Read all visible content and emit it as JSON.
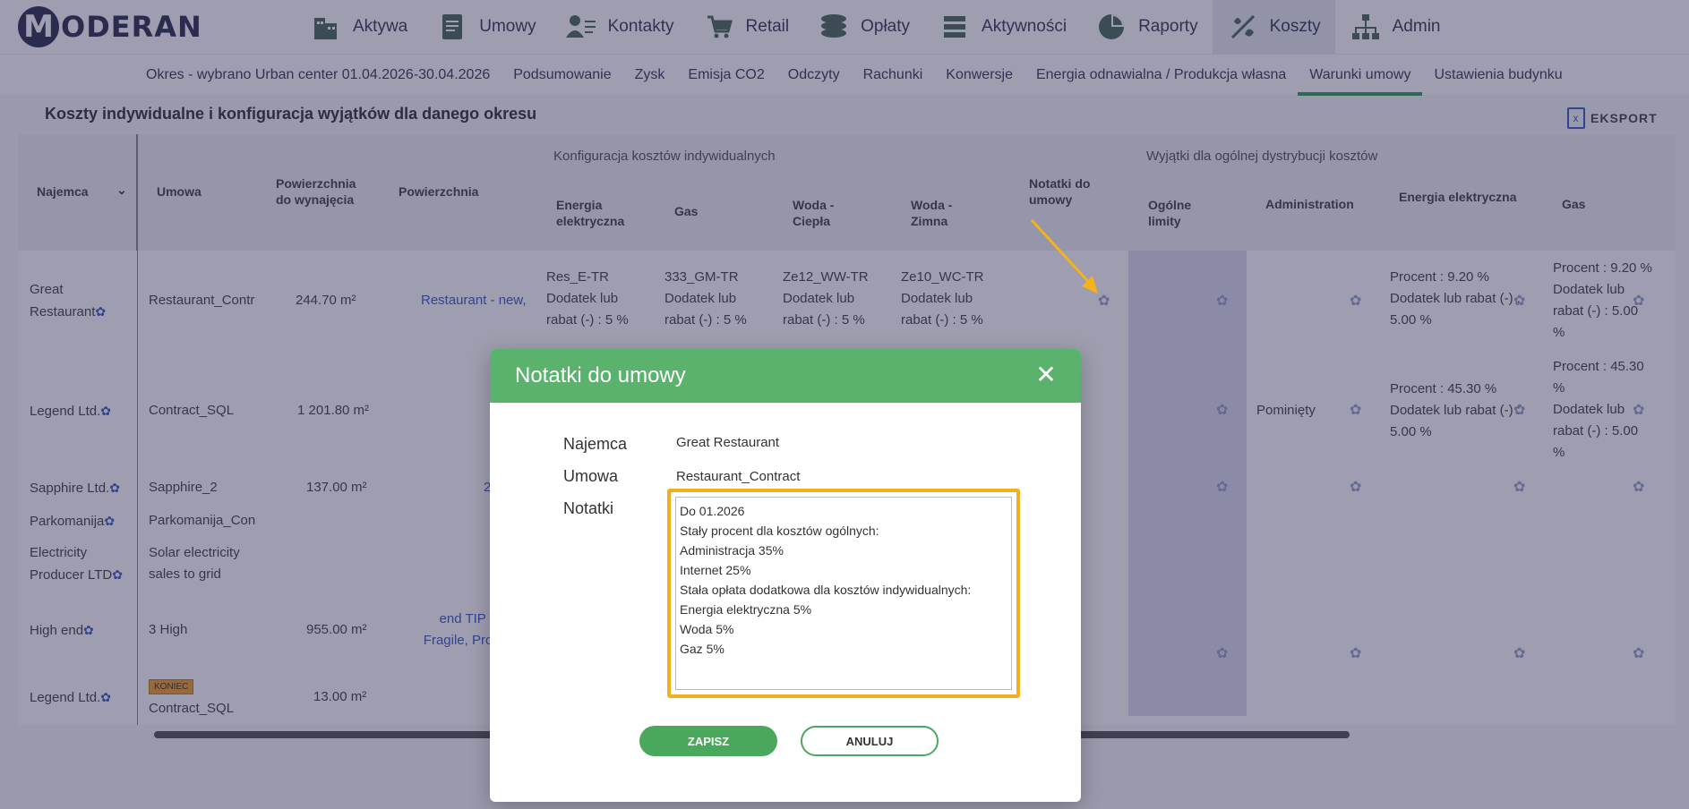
{
  "brand": {
    "logo_letter": "M",
    "logo_text": "ODERAN"
  },
  "nav": [
    {
      "label": "Aktywa",
      "icon": "building-icon"
    },
    {
      "label": "Umowy",
      "icon": "document-icon"
    },
    {
      "label": "Kontakty",
      "icon": "contacts-icon"
    },
    {
      "label": "Retail",
      "icon": "cart-icon"
    },
    {
      "label": "Opłaty",
      "icon": "coins-icon"
    },
    {
      "label": "Aktywności",
      "icon": "list-icon"
    },
    {
      "label": "Raporty",
      "icon": "pie-chart-icon"
    },
    {
      "label": "Koszty",
      "icon": "costs-icon",
      "active": true
    },
    {
      "label": "Admin",
      "icon": "org-chart-icon"
    }
  ],
  "subnav": [
    {
      "label": "Okres - wybrano Urban center 01.04.2026-30.04.2026"
    },
    {
      "label": "Podsumowanie"
    },
    {
      "label": "Zysk"
    },
    {
      "label": "Emisja CO2"
    },
    {
      "label": "Odczyty"
    },
    {
      "label": "Rachunki"
    },
    {
      "label": "Konwersje"
    },
    {
      "label": "Energia odnawialna / Produkcja własna"
    },
    {
      "label": "Warunki umowy",
      "active": true
    },
    {
      "label": "Ustawienia budynku"
    }
  ],
  "section": {
    "title": "Koszty indywidualne i konfiguracja wyjątków dla danego okresu",
    "export_label": "EKSPORT"
  },
  "table": {
    "group_individual": "Konfiguracja kosztów indywidualnych",
    "group_exceptions": "Wyjątki dla ogólnej dystrybucji kosztów",
    "headers": {
      "tenant": "Najemca",
      "contract": "Umowa",
      "area_rent": "Powierzchnia do wynajęcia",
      "area": "Powierzchnia",
      "energy": "Energia elektryczna",
      "gas": "Gas",
      "water_hot": "Woda - Ciepła",
      "water_cold": "Woda - Zimna",
      "notes": "Notatki do umowy",
      "general_limits": "Ogólne limity",
      "administration": "Administration",
      "ex_energy": "Energia elektryczna",
      "ex_gas": "Gas"
    },
    "rows": [
      {
        "tenant": "Great Restaurant",
        "contract": "Restaurant_Contr",
        "area_rent": "244.70 m²",
        "area": "Restaurant - new,",
        "energy": [
          "Res_E-TR",
          "Dodatek lub",
          "rabat (-) : 5 %"
        ],
        "gas": [
          "333_GM-TR",
          "Dodatek lub",
          "rabat (-) : 5 %"
        ],
        "water_hot": [
          "Ze12_WW-TR",
          "Dodatek lub",
          "rabat (-) : 5 %"
        ],
        "water_cold": [
          "Ze10_WC-TR",
          "Dodatek lub",
          "rabat (-) : 5 %"
        ],
        "ex_energy": [
          "Procent : 9.20 %",
          "Dodatek lub rabat (-) :",
          "5.00 %"
        ],
        "ex_gas": [
          "Procent : 9.20 %",
          "Dodatek lub",
          "rabat (-) : 5.00",
          "%"
        ]
      },
      {
        "tenant": "Legend Ltd.",
        "contract": "Contract_SQL",
        "area_rent": "1 201.80 m²",
        "administration": "Pominięty",
        "ex_energy": [
          "Procent : 45.30 %",
          "Dodatek lub rabat (-) :",
          "5.00 %"
        ],
        "ex_gas": [
          "Procent : 45.30",
          "%",
          "Dodatek lub",
          "rabat (-) : 5.00",
          "%"
        ]
      },
      {
        "tenant": "Sapphire Ltd.",
        "contract": "Sapphire_2",
        "area_rent": "137.00 m²",
        "area": "2"
      },
      {
        "tenant": "Parkomanija",
        "contract": "Parkomanija_Con"
      },
      {
        "tenant": "Electricity Producer LTD",
        "contract": "Solar electricity sales to grid"
      },
      {
        "tenant": "High end",
        "contract": "3 High",
        "area_rent": "955.00 m²",
        "area": "end TIP TO Fragile, Produ"
      },
      {
        "tenant": "Legend Ltd.",
        "contract": "Contract_SQL",
        "badge": "KONIEC",
        "area_rent": "13.00 m²"
      }
    ]
  },
  "modal": {
    "title": "Notatki do umowy",
    "tenant_label": "Najemca",
    "tenant_value": "Great Restaurant",
    "contract_label": "Umowa",
    "contract_value": "Restaurant_Contract",
    "notes_label": "Notatki",
    "notes_value": "Do 01.2026\nStały procent dla kosztów ogólnych:\nAdministracja 35%\nInternet 25%\nStała opłata dodatkowa dla kosztów indywidualnych:\nEnergia elektryczna 5%\nWoda 5%\nGaz 5%",
    "save_label": "ZAPISZ",
    "cancel_label": "ANULUJ"
  },
  "colors": {
    "accent_green": "#5bb26c",
    "highlight": "#f2b01e",
    "link_blue": "#3b5bc6"
  }
}
